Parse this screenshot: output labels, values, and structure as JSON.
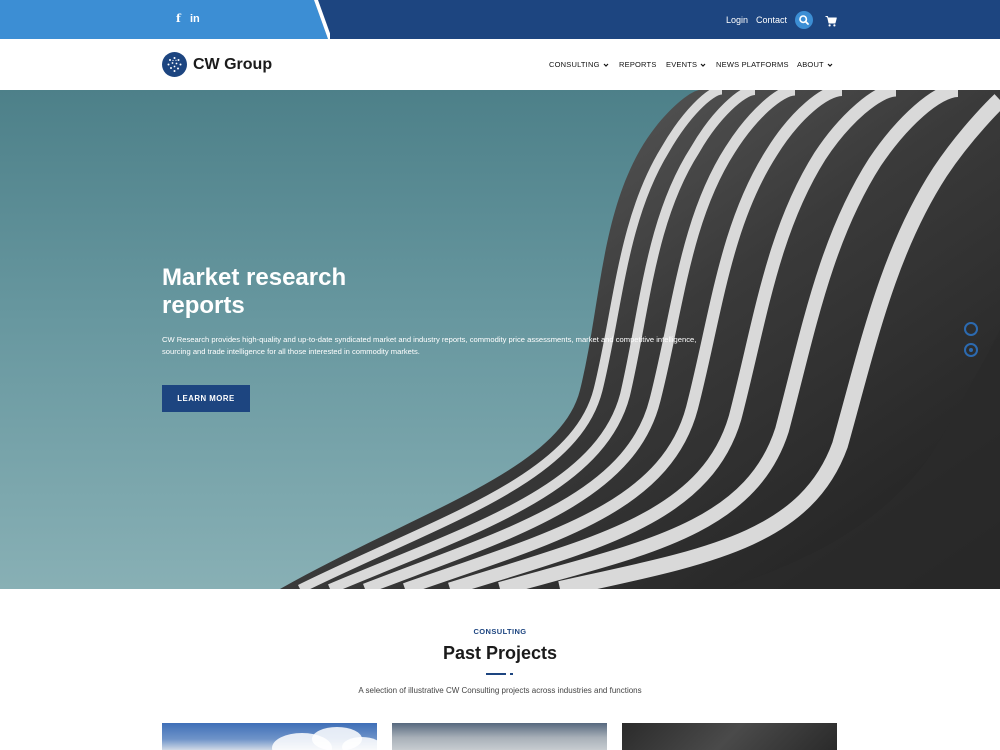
{
  "topbar": {
    "social": {
      "facebook": "f",
      "linkedin": "in"
    },
    "links": {
      "login": "Login",
      "contact": "Contact"
    },
    "icons": {
      "search": "search-icon",
      "cart": "cart-icon"
    }
  },
  "brand": {
    "name": "CW Group"
  },
  "nav": {
    "items": [
      {
        "label": "CONSULTING",
        "dropdown": true
      },
      {
        "label": "REPORTS",
        "dropdown": false
      },
      {
        "label": "EVENTS",
        "dropdown": true
      },
      {
        "label": "NEWS PLATFORMS",
        "dropdown": false
      },
      {
        "label": "ABOUT",
        "dropdown": true
      }
    ]
  },
  "hero": {
    "title": "Market research reports",
    "description": "CW Research provides high-quality and up-to-date syndicated market and industry reports, commodity price assessments, market and competitive intelligence, sourcing and trade intelligence for all those interested in commodity markets.",
    "cta": "LEARN MORE"
  },
  "projects": {
    "eyebrow": "CONSULTING",
    "title": "Past Projects",
    "subtitle": "A selection of illustrative CW Consulting projects across industries and functions"
  },
  "colors": {
    "brand_dark": "#1d4580",
    "brand_light": "#3c8ed4",
    "accent": "#2c6ab0"
  }
}
